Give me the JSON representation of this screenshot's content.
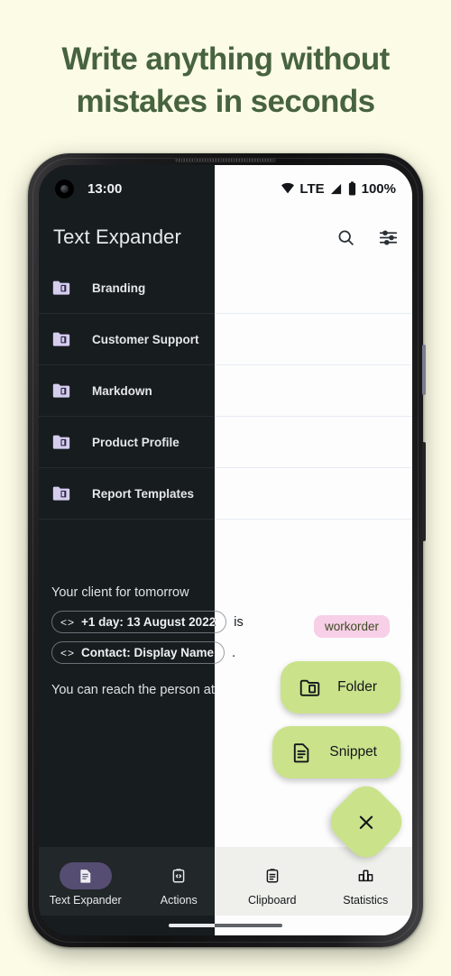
{
  "headline": {
    "line1": "Write anything without",
    "line2": "mistakes in seconds",
    "color": "#47633f"
  },
  "background_color": "#fcfce6",
  "phone": {
    "status_bar": {
      "time": "13:00",
      "network": "LTE",
      "battery": "100%",
      "icons": [
        "wifi-icon",
        "signal-icon",
        "battery-icon"
      ]
    },
    "app_bar": {
      "title": "Text Expander",
      "search_icon": "search-icon",
      "filter_icon": "tune-icon"
    },
    "folders": [
      {
        "label": "Branding",
        "icon": "folder-icon"
      },
      {
        "label": "Customer Support",
        "icon": "folder-icon"
      },
      {
        "label": "Markdown",
        "icon": "folder-icon"
      },
      {
        "label": "Product Profile",
        "icon": "folder-icon"
      },
      {
        "label": "Report Templates",
        "icon": "folder-icon"
      }
    ],
    "snippet": {
      "line1": "Your client for tomorrow",
      "chip1": "+1 day: 13 August 2022",
      "chip1_code": "<>",
      "chip1_suffix": "is",
      "chip2": "Contact: Display Name",
      "chip2_code": "<>",
      "chip2_suffix": ".",
      "line_last": "You can reach the person at"
    },
    "fab": {
      "tag": "workorder",
      "tag_bg": "#f7cfe6",
      "accent": "#cae38b",
      "items": [
        {
          "label": "Folder",
          "icon": "folder-icon"
        },
        {
          "label": "Snippet",
          "icon": "document-icon"
        }
      ],
      "close_icon": "close-icon"
    },
    "bottom_nav": [
      {
        "label": "Text Expander",
        "icon": "document-icon",
        "active": true
      },
      {
        "label": "Actions",
        "icon": "clipboard-code-icon",
        "active": false
      },
      {
        "label": "Clipboard",
        "icon": "clipboard-icon",
        "active": false
      },
      {
        "label": "Statistics",
        "icon": "bar-chart-icon",
        "active": false
      }
    ],
    "nav_indicator": "home-indicator",
    "active_pill_color": "#564d73",
    "folder_icon_color": "#d5cdee"
  }
}
